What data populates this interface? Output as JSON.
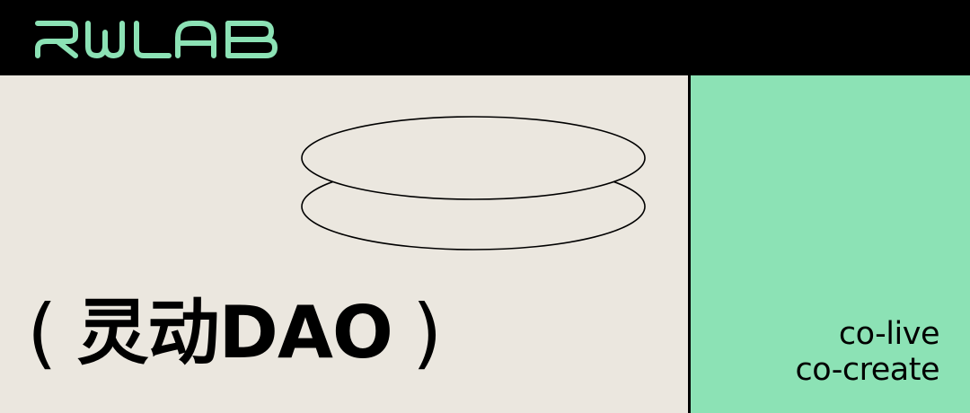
{
  "brand": {
    "logo_text": "RWLAB",
    "logo_color": "#8ce2b5"
  },
  "title": {
    "open_paren": "(",
    "text": "灵动DAO",
    "close_paren": ")"
  },
  "tagline": {
    "line1": "co-live",
    "line2": "co-create"
  },
  "colors": {
    "header_bg": "#000000",
    "left_bg": "#ebe7df",
    "accent_green": "#8ce2b5",
    "text": "#000000"
  },
  "icons": {
    "discs": "stacked-ellipses-icon"
  }
}
